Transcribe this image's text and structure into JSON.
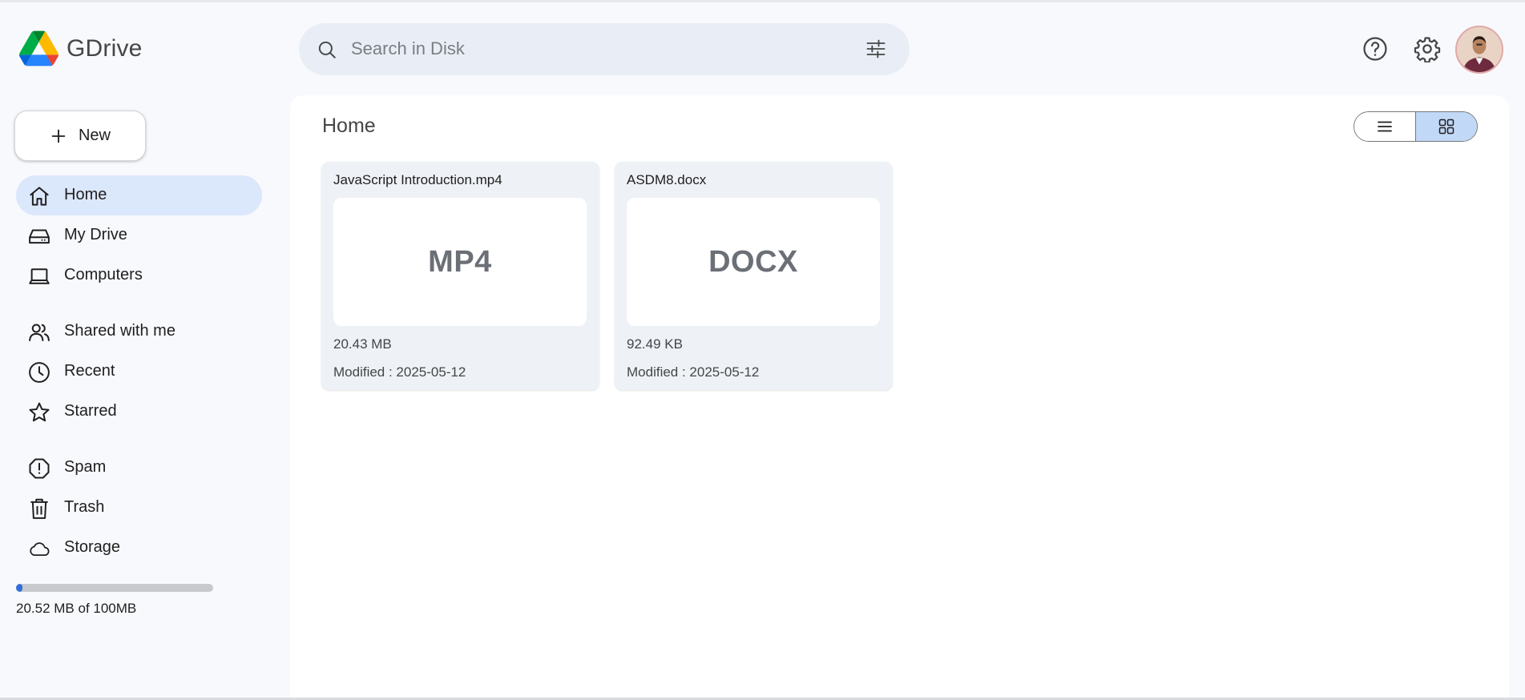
{
  "app": {
    "name": "GDrive",
    "logo_icon": "gdrive-logo-icon"
  },
  "search": {
    "placeholder": "Search in Disk",
    "value": "",
    "icon": "search-icon",
    "filter_icon": "filter-sliders-icon"
  },
  "header": {
    "help_icon": "help-circle-icon",
    "settings_icon": "gear-icon",
    "avatar": "avatar"
  },
  "new_button": {
    "label": "New",
    "icon": "plus-icon"
  },
  "sidebar": {
    "items": [
      {
        "label": "Home",
        "icon": "home-icon",
        "active": true
      },
      {
        "label": "My Drive",
        "icon": "drive-icon",
        "active": false
      },
      {
        "label": "Computers",
        "icon": "laptop-icon",
        "active": false
      },
      {
        "label": "Shared with me",
        "icon": "people-icon",
        "active": false
      },
      {
        "label": "Recent",
        "icon": "clock-icon",
        "active": false
      },
      {
        "label": "Starred",
        "icon": "star-icon",
        "active": false
      },
      {
        "label": "Spam",
        "icon": "spam-icon",
        "active": false
      },
      {
        "label": "Trash",
        "icon": "trash-icon",
        "active": false
      },
      {
        "label": "Storage",
        "icon": "cloud-icon",
        "active": false
      }
    ]
  },
  "storage": {
    "text": "20.52 MB of 100MB",
    "used_fraction": 0.2052
  },
  "main": {
    "title": "Home",
    "view_mode": "grid",
    "view_toggle": {
      "list_icon": "list-view-icon",
      "grid_icon": "grid-view-icon"
    },
    "files": [
      {
        "name": "JavaScript Introduction.mp4",
        "type": "MP4",
        "size": "20.43 MB",
        "modified": "Modified : 2025-05-12"
      },
      {
        "name": "ASDM8.docx",
        "type": "DOCX",
        "size": "92.49 KB",
        "modified": "Modified : 2025-05-12"
      }
    ]
  },
  "colors": {
    "accent": "#2f6fd7",
    "active_nav": "#dbe7fb",
    "search_bg": "#e9eef6",
    "card_bg": "#eef1f6"
  }
}
